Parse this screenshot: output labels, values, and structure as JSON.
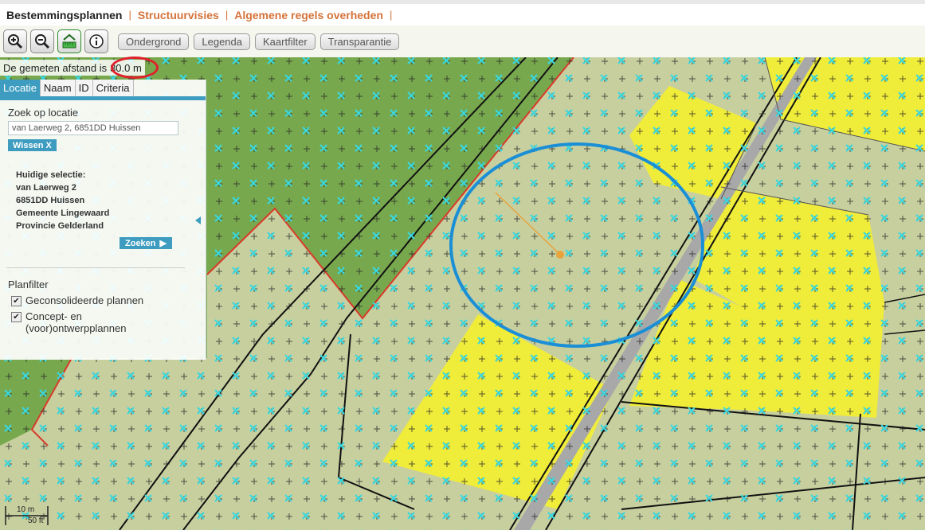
{
  "topnav": {
    "tabs": [
      {
        "label": "Bestemmingsplannen",
        "active": true
      },
      {
        "label": "Structuurvisies",
        "active": false
      },
      {
        "label": "Algemene regels overheden",
        "active": false
      }
    ],
    "separator": "|"
  },
  "toolbar": {
    "icons": [
      "zoom-in-icon",
      "zoom-out-icon",
      "measure-icon",
      "info-icon"
    ],
    "buttons": [
      "Ondergrond",
      "Legenda",
      "Kaartfilter",
      "Transparantie"
    ]
  },
  "measure": {
    "label": "De gemeten afstand is",
    "value": "30.0 m"
  },
  "panel": {
    "tabs": [
      "Locatie",
      "Naam",
      "ID",
      "Criteria"
    ],
    "search_label": "Zoek op locatie",
    "search_value": "van Laerweg 2, 6851DD Huissen",
    "clear_button": "Wissen X",
    "selection": {
      "heading": "Huidige selectie:",
      "street": "van Laerweg 2",
      "postal": "6851DD Huissen",
      "municipality": "Gemeente Lingewaard",
      "province": "Provincie Gelderland"
    },
    "search_button": "Zoeken",
    "planfilter": {
      "title": "Planfilter",
      "options": [
        {
          "label": "Geconsolideerde plannen",
          "checked": true
        },
        {
          "label": "Concept- en (voor)ontwerpplannen",
          "checked": true
        }
      ]
    }
  },
  "scale": {
    "primary": "10 m",
    "secondary": "50 ft"
  },
  "colors": {
    "accent": "#3d9cbf",
    "nav_link": "#d4733a",
    "forest": "#78a84e",
    "farmland": "#c8cf9f",
    "residential": "#f0ec3a",
    "highlight_circle": "#1a8fd6",
    "distance_marker": "#e0202a"
  }
}
